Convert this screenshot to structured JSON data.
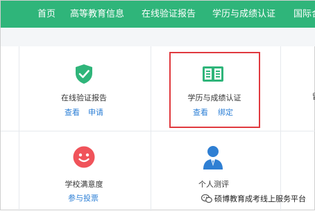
{
  "nav": {
    "items": [
      "首页",
      "高等教育信息",
      "在线验证报告",
      "学历与成绩认证",
      "国际合"
    ]
  },
  "cards": {
    "online_report": {
      "title": "在线验证报告",
      "link1": "查看",
      "link2": "申请"
    },
    "degree_cert": {
      "title": "学历与成绩认证",
      "link1": "查看",
      "link2": "绑定"
    },
    "satisfaction": {
      "title": "学校满意度",
      "link1": "参与投票"
    },
    "personal_eval": {
      "title": "个人测评"
    },
    "edge_text": "留"
  },
  "watermark": {
    "text": "硕博教育成考线上服务平台"
  },
  "colors": {
    "nav": "#2fb57a",
    "accent_green": "#2fb57a",
    "link_blue": "#2c7fd6",
    "highlight_red": "#e0393e",
    "smile_red": "#f0535a",
    "person_blue": "#2f7fd3"
  }
}
